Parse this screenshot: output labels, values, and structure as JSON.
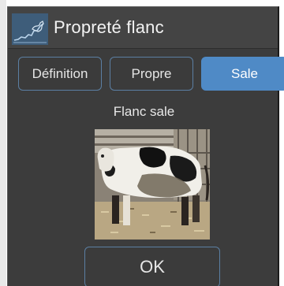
{
  "dialog": {
    "title": "Propreté flanc",
    "logo_icon": "cow-chart-logo-icon"
  },
  "tabs": [
    {
      "label": "Définition",
      "active": false
    },
    {
      "label": "Propre",
      "active": false
    },
    {
      "label": "Sale",
      "active": true
    }
  ],
  "content": {
    "caption": "Flanc sale",
    "image": "photo of a black-and-white cow with dirty flank standing in a pen"
  },
  "footer": {
    "ok_label": "OK"
  },
  "colors": {
    "dialog_bg": "#3c3c3c",
    "accent": "#4f8ac6",
    "border": "#5b7fa3",
    "text": "#e6e6e6"
  }
}
